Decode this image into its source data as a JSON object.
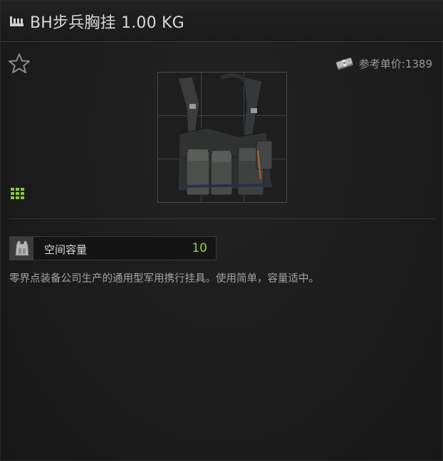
{
  "header": {
    "title": "BH步兵胸挂 1.00 KG",
    "title_icon": "item-category-icon"
  },
  "favorite": {
    "icon": "star-outline-icon"
  },
  "price": {
    "icon": "money-icon",
    "text": "参考单价:1389"
  },
  "item": {
    "icon": "chest-rig-image",
    "grid_size_icon": "grid-size-icon"
  },
  "attributes": [
    {
      "icon": "vest-icon",
      "label": "空间容量",
      "value": "10",
      "value_color": "#9fd12c"
    }
  ],
  "description": "零界点装备公司生产的通用型军用携行挂具。使用简单，容量适中。"
}
